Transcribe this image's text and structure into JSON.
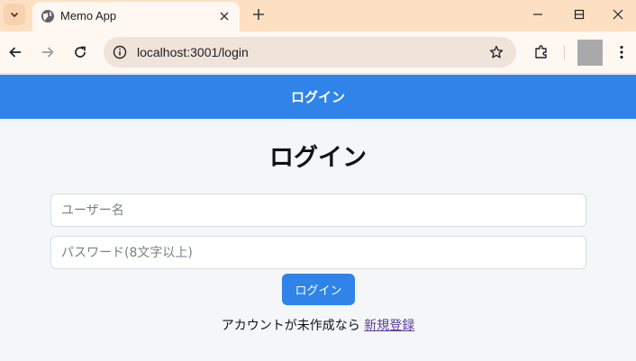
{
  "browser": {
    "tab": {
      "title": "Memo App"
    },
    "address_bar": {
      "url": "localhost:3001/login"
    }
  },
  "header": {
    "title": "ログイン"
  },
  "form": {
    "title": "ログイン",
    "username": {
      "placeholder": "ユーザー名",
      "value": ""
    },
    "password": {
      "placeholder": "パスワード(8文字以上)",
      "value": ""
    },
    "submit_label": "ログイン"
  },
  "signup": {
    "prompt": "アカウントが未作成なら",
    "link_label": "新規登録"
  },
  "colors": {
    "accent": "#2f83e9",
    "tabstrip": "#fde0c2",
    "page_background": "#f4f6f8",
    "link_visited": "#5a3d9e"
  },
  "icons": {
    "tab_list": "chevron-down-icon",
    "favicon": "globe-icon",
    "tab_close": "close-icon",
    "new_tab": "plus-icon",
    "minimize": "minimize-icon",
    "maximize": "maximize-icon",
    "window_close": "close-icon",
    "back": "back-arrow-icon",
    "forward": "forward-arrow-icon",
    "reload": "reload-icon",
    "site_info": "info-icon",
    "bookmark": "star-icon",
    "extensions": "puzzle-icon",
    "menu": "kebab-menu-icon"
  }
}
